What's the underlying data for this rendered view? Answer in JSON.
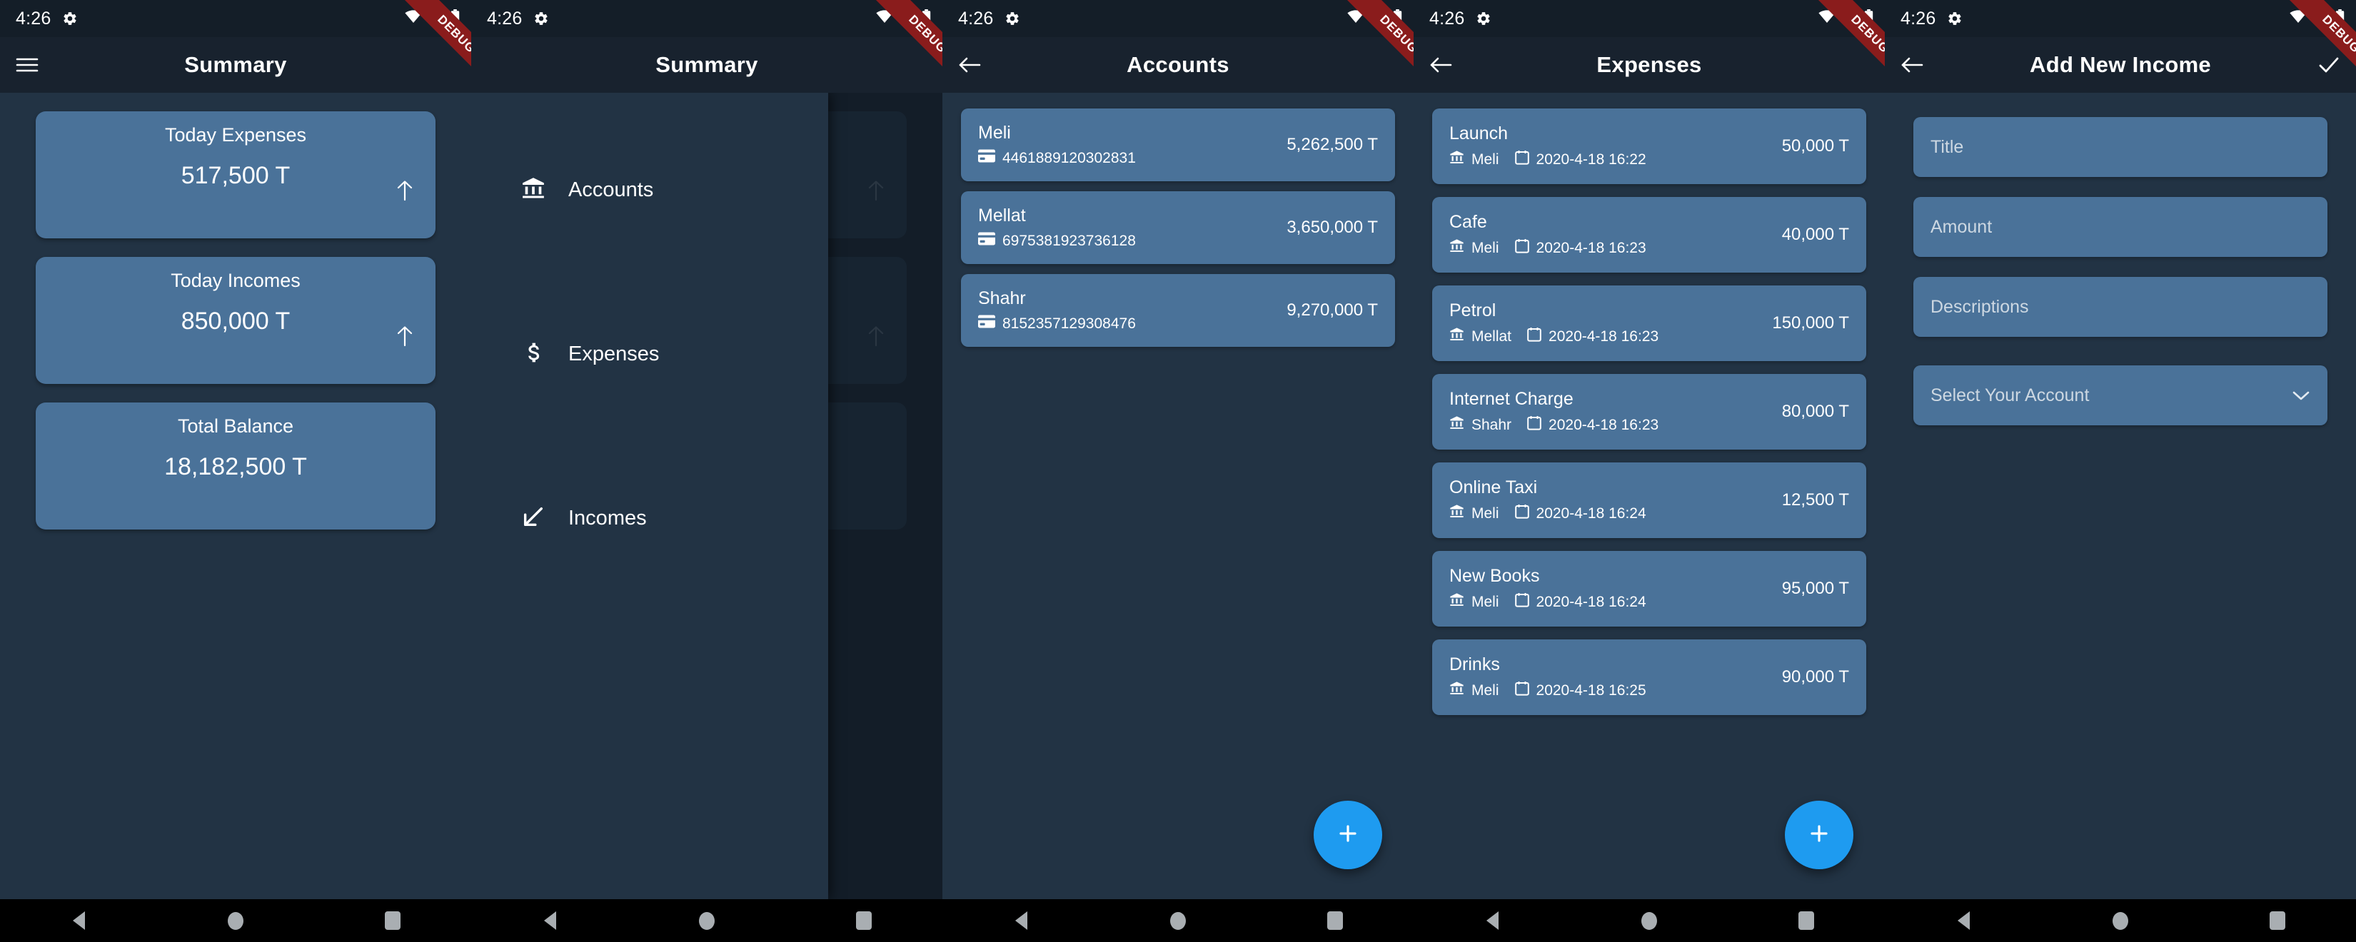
{
  "status_bar": {
    "time": "4:26",
    "gear_icon": "gear-icon",
    "wifi_icon": "wifi-icon",
    "signal_icon": "signal-icon",
    "battery_icon": "battery-icon"
  },
  "debug_banner": "DEBUG",
  "colors": {
    "card": "#4a7299",
    "background": "#223344",
    "appbar": "#18222e",
    "statusbar": "#141e28",
    "fab": "#1e9bf0",
    "debug": "#8a1c1c",
    "navbar": "#000000"
  },
  "nav_bar": {
    "back_label": "back",
    "home_label": "home",
    "recents_label": "recents"
  },
  "screens": [
    {
      "id": "summary",
      "appbar": {
        "title": "Summary",
        "leading_icon": "menu-icon"
      },
      "cards": [
        {
          "title": "Today Expenses",
          "value": "517,500 T",
          "arrow": "arrow-up-icon"
        },
        {
          "title": "Today Incomes",
          "value": "850,000 T",
          "arrow": "arrow-up-icon"
        },
        {
          "title": "Total Balance",
          "value": "18,182,500 T",
          "arrow": null
        }
      ]
    },
    {
      "id": "drawer",
      "appbar": {
        "title": "Summary",
        "leading_icon": "menu-icon"
      },
      "drawer_items": [
        {
          "label": "Accounts",
          "icon": "bank-icon"
        },
        {
          "label": "Expenses",
          "icon": "dollar-icon"
        },
        {
          "label": "Incomes",
          "icon": "arrow-down-left-icon"
        }
      ]
    },
    {
      "id": "accounts",
      "appbar": {
        "title": "Accounts",
        "leading_icon": "arrow-back-icon"
      },
      "accounts": [
        {
          "name": "Meli",
          "card_number": "4461889120302831",
          "balance": "5,262,500 T",
          "icon": "credit-card-icon"
        },
        {
          "name": "Mellat",
          "card_number": "6975381923736128",
          "balance": "3,650,000 T",
          "icon": "credit-card-icon"
        },
        {
          "name": "Shahr",
          "card_number": "8152357129308476",
          "balance": "9,270,000 T",
          "icon": "credit-card-icon"
        }
      ],
      "fab": {
        "icon": "plus-icon"
      }
    },
    {
      "id": "expenses",
      "appbar": {
        "title": "Expenses",
        "leading_icon": "arrow-back-icon"
      },
      "expenses": [
        {
          "title": "Launch",
          "account": "Meli",
          "date": "2020-4-18 16:22",
          "amount": "50,000 T"
        },
        {
          "title": "Cafe",
          "account": "Meli",
          "date": "2020-4-18 16:23",
          "amount": "40,000 T"
        },
        {
          "title": "Petrol",
          "account": "Mellat",
          "date": "2020-4-18 16:23",
          "amount": "150,000 T"
        },
        {
          "title": "Internet Charge",
          "account": "Shahr",
          "date": "2020-4-18 16:23",
          "amount": "80,000 T"
        },
        {
          "title": "Online Taxi",
          "account": "Meli",
          "date": "2020-4-18 16:24",
          "amount": "12,500 T"
        },
        {
          "title": "New Books",
          "account": "Meli",
          "date": "2020-4-18 16:24",
          "amount": "95,000 T"
        },
        {
          "title": "Drinks",
          "account": "Meli",
          "date": "2020-4-18 16:25",
          "amount": "90,000 T"
        }
      ],
      "fab": {
        "icon": "plus-icon"
      }
    },
    {
      "id": "add_income",
      "appbar": {
        "title": "Add New Income",
        "leading_icon": "arrow-back-icon",
        "trailing_icon": "check-icon"
      },
      "fields": [
        {
          "name": "title",
          "placeholder": "Title",
          "value": ""
        },
        {
          "name": "amount",
          "placeholder": "Amount",
          "value": ""
        },
        {
          "name": "descriptions",
          "placeholder": "Descriptions",
          "value": ""
        }
      ],
      "select": {
        "placeholder": "Select Your Account",
        "value": "",
        "chevron": "chevron-down-icon"
      }
    }
  ]
}
